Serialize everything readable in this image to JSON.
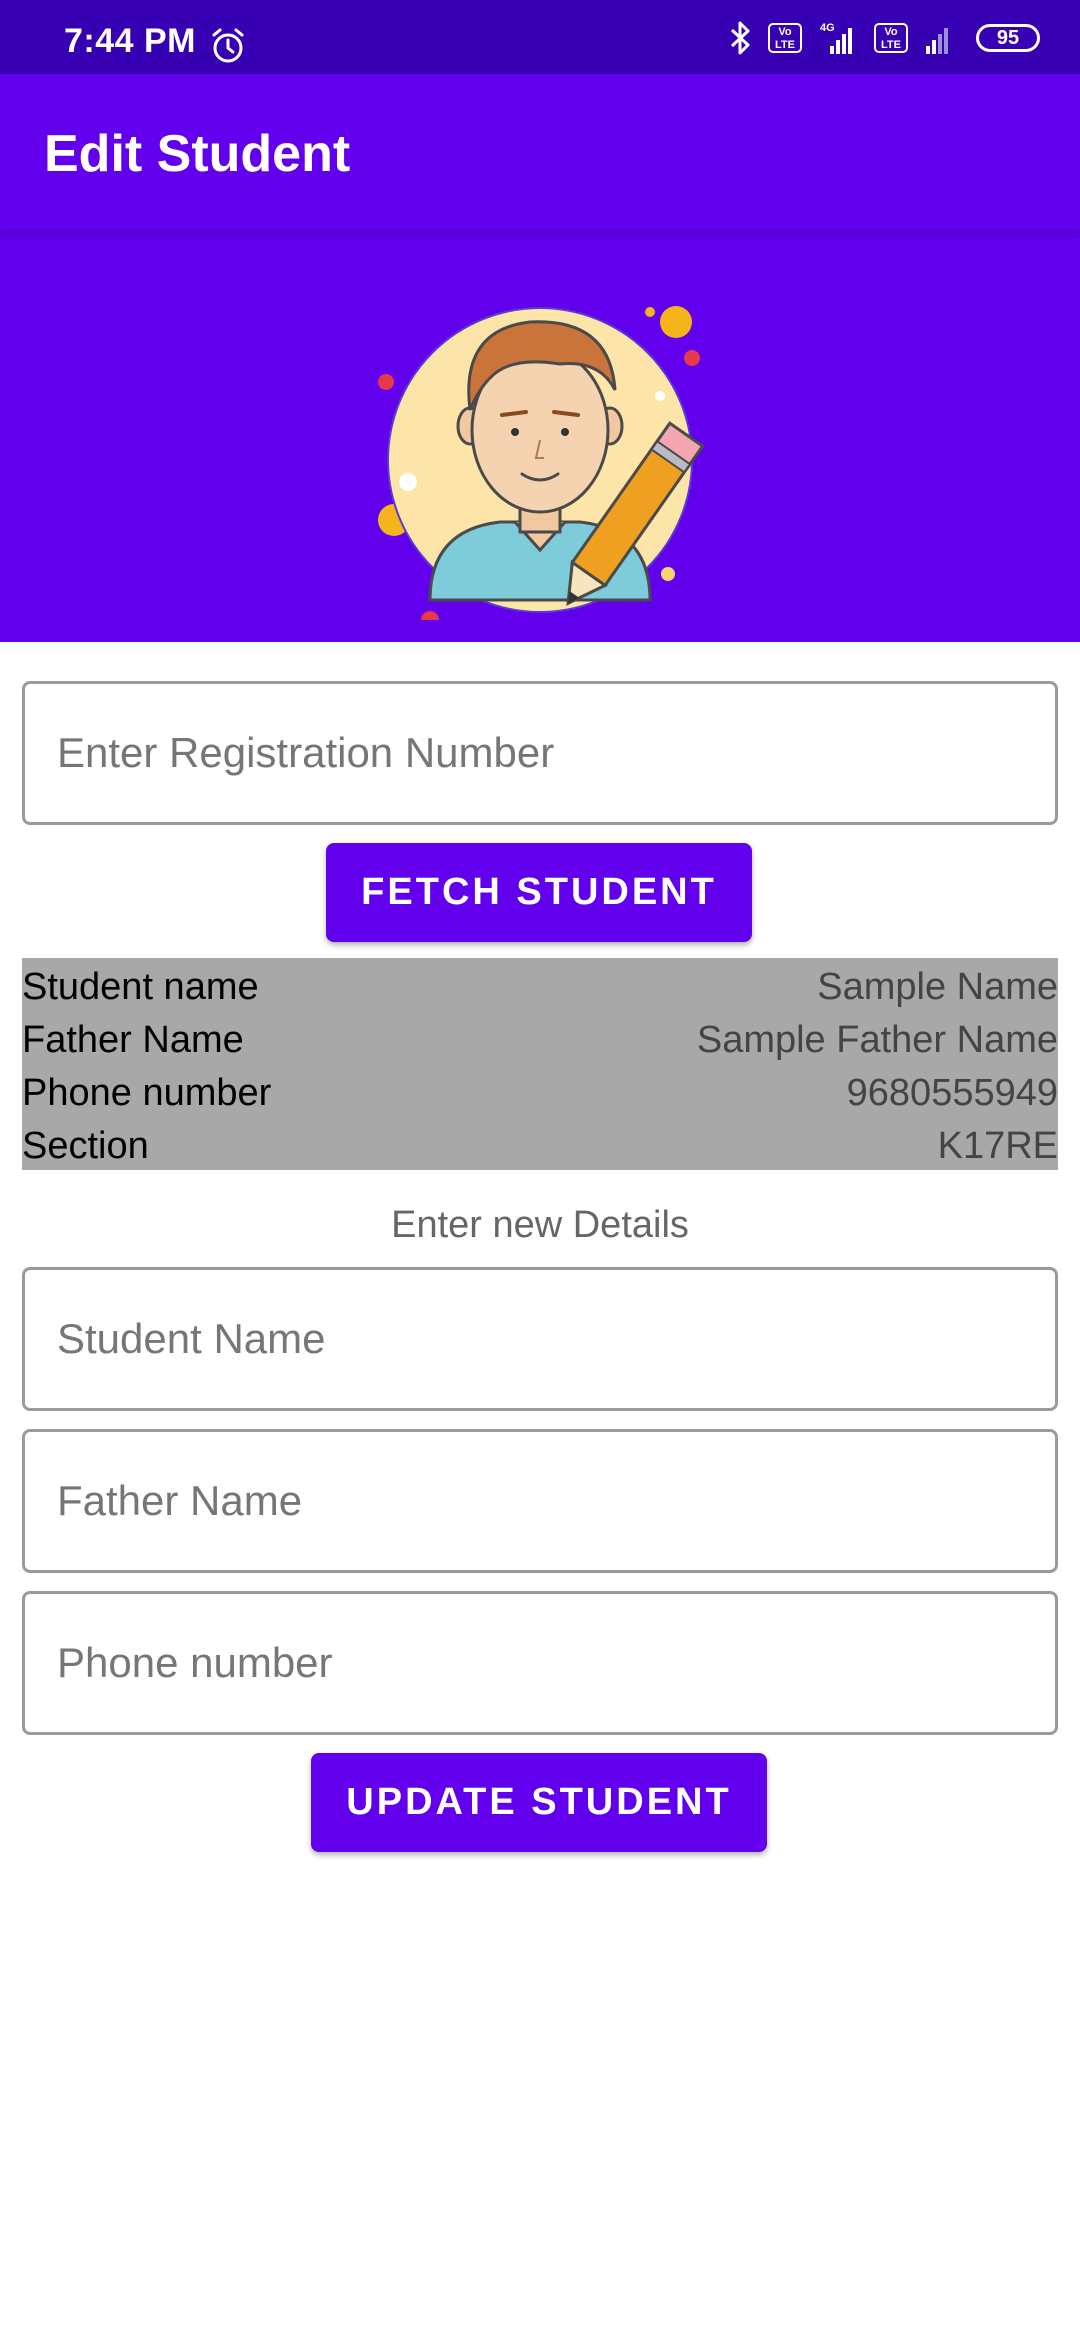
{
  "status_bar": {
    "time": "7:44 PM",
    "battery": "95",
    "volte_label": "Vo LTE",
    "network": "4G"
  },
  "app_bar": {
    "title": "Edit Student"
  },
  "fetch_form": {
    "registration_placeholder": "Enter Registration Number",
    "fetch_button": "FETCH STUDENT"
  },
  "student_info": [
    {
      "label": "Student name",
      "value": "Sample Name"
    },
    {
      "label": "Father Name",
      "value": "Sample Father Name"
    },
    {
      "label": "Phone number",
      "value": "9680555949"
    },
    {
      "label": "Section",
      "value": "K17RE"
    }
  ],
  "update_form": {
    "heading": "Enter new Details",
    "student_name_placeholder": "Student Name",
    "father_name_placeholder": "Father Name",
    "phone_placeholder": "Phone number",
    "update_button": "UPDATE STUDENT"
  },
  "colors": {
    "primary": "#6200EE",
    "primary_dark": "#3700B3",
    "info_background": "#A8A8A8"
  },
  "icons": [
    "alarm-icon",
    "bluetooth-icon",
    "signal-icon",
    "battery-icon",
    "student-avatar-illustration"
  ]
}
